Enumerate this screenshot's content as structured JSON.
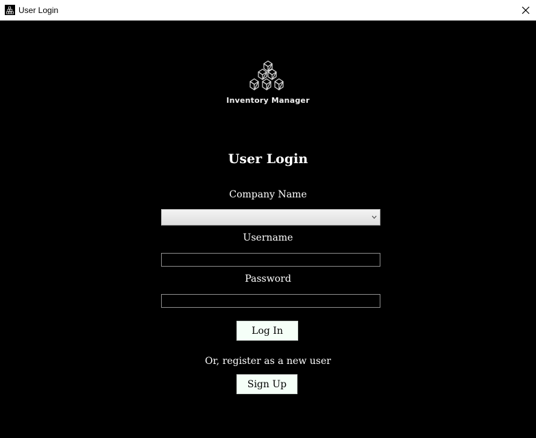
{
  "window": {
    "title": "User Login",
    "app_icon": "inventory-app-icon",
    "close_icon": "close-icon"
  },
  "branding": {
    "logo_icon": "stacked-boxes-logo",
    "name": "Inventory Manager"
  },
  "form": {
    "heading": "User Login",
    "company": {
      "label": "Company Name",
      "selected": ""
    },
    "username": {
      "label": "Username",
      "value": ""
    },
    "password": {
      "label": "Password",
      "value": ""
    },
    "login_label": "Log In",
    "register_prompt": "Or, register as a new user",
    "signup_label": "Sign Up"
  },
  "colors": {
    "background": "#000000",
    "titlebar": "#ffffff",
    "button_bg": "#f5fff8",
    "text": "#ffffff"
  }
}
